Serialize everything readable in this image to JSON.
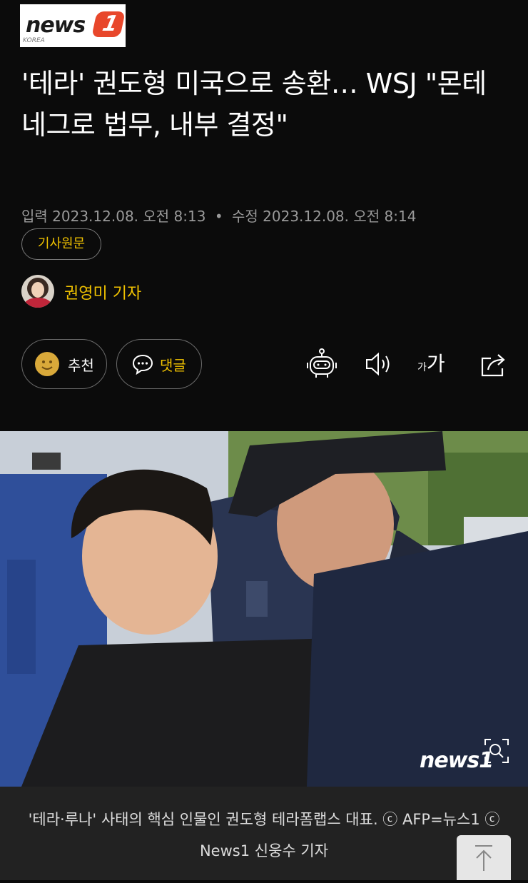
{
  "logo": {
    "word": "news",
    "badge": "1",
    "sub": "KOREA"
  },
  "article": {
    "headline": "'테라' 권도형 미국으로 송환… WSJ \"몬테네그로 법무, 내부 결정\"",
    "input_date": "입력 2023.12.08. 오전 8:13",
    "separator": "•",
    "modified_date": "수정 2023.12.08. 오전 8:14",
    "original_label": "기사원문",
    "reporter": "권영미 기자"
  },
  "actions": {
    "like_label": "추천",
    "comment_label": "댓글",
    "font_small": "가",
    "font_big": "가"
  },
  "photo": {
    "watermark": "news",
    "watermark_badge": "1",
    "caption": "'테라·루나' 사태의 핵심 인물인 권도형 테라폼랩스 대표. ⓒ AFP=뉴스1 ⓒ News1 신웅수 기자"
  },
  "colors": {
    "background": "#0b0b0b",
    "accent_yellow": "#f0c200",
    "brand_orange": "#e8472b",
    "caption_bg": "#222222"
  },
  "icons": [
    "robot-icon",
    "speaker-icon",
    "font-size-icon",
    "share-icon",
    "zoom-icon",
    "arrow-up-icon",
    "smile-icon",
    "comment-icon"
  ]
}
